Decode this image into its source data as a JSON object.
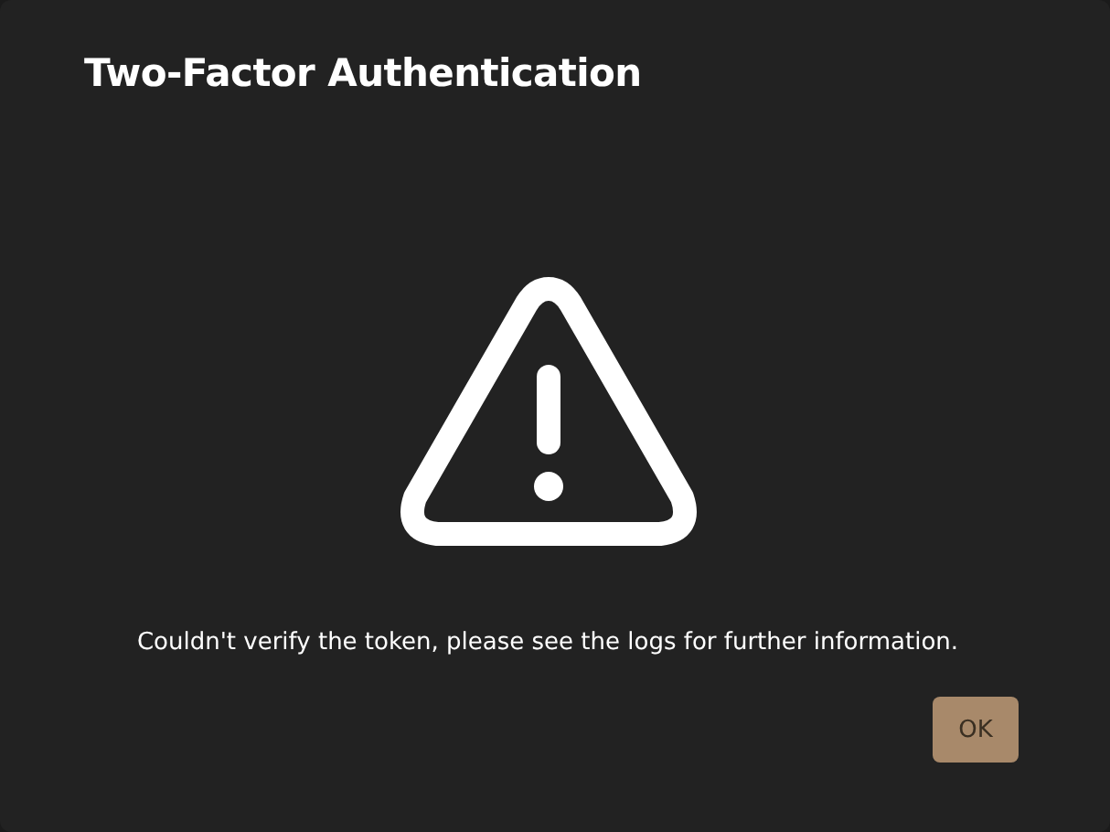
{
  "dialog": {
    "title": "Two-Factor Authentication",
    "message": "Couldn't verify the token, please see the logs for further information.",
    "buttons": [
      {
        "label": "OK"
      }
    ]
  }
}
